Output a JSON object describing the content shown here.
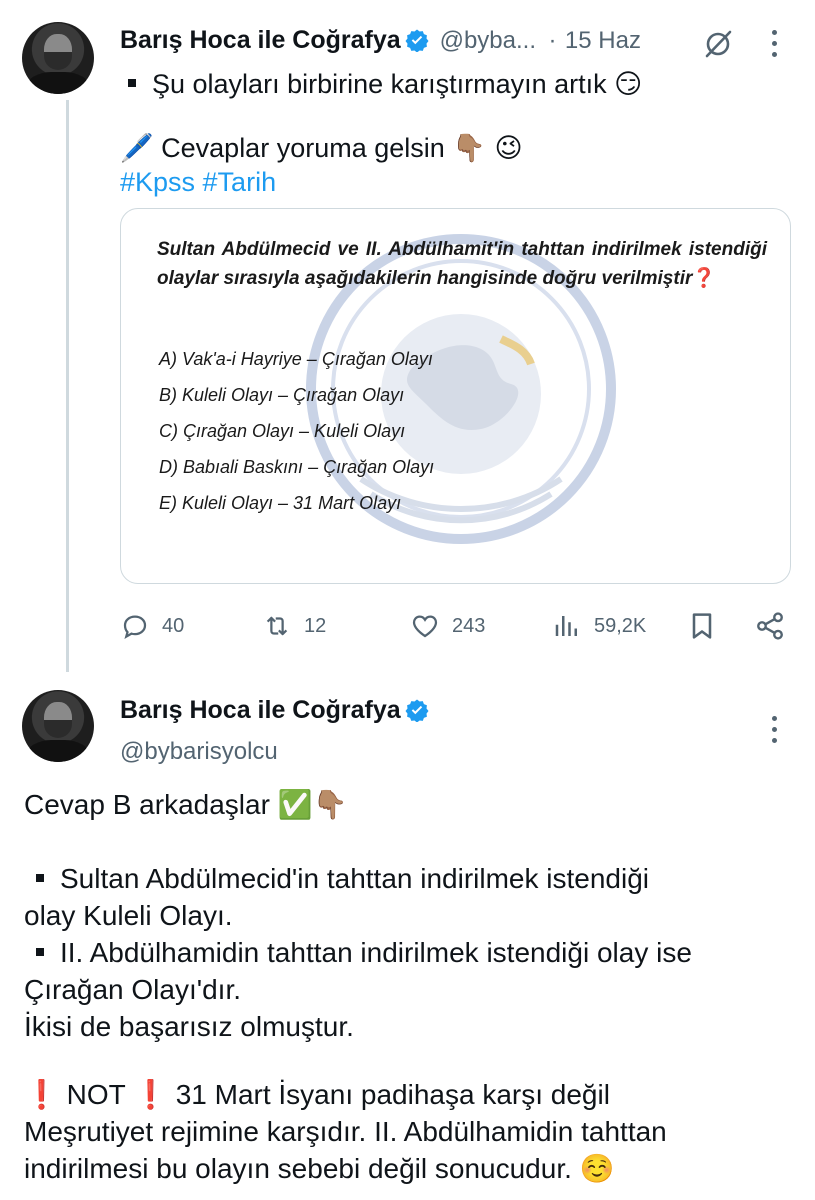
{
  "tweet1": {
    "author_name": "Barış Hoca ile Coğrafya",
    "handle": "@byba...",
    "dot": "·",
    "time": "15 Haz",
    "line1": "Şu olayları birbirine karıştırmayın artık",
    "line1_emoji": "😏",
    "line2_emoji": "🖊️",
    "line2": "Cevaplar yoruma gelsin",
    "line2_emoji_end": "👇🏽 😉",
    "hashtags": "#Kpss #Tarih",
    "image": {
      "question": "Sultan Abdülmecid ve II. Abdülhamit'in tahttan indirilmek istendiği olaylar sırasıyla aşağıdakilerin hangisinde doğru verilmiştir",
      "question_mark": "❓",
      "options": [
        "A) Vak'a-i Hayriye – Çırağan Olayı",
        "B) Kuleli Olayı – Çırağan Olayı",
        "C) Çırağan Olayı – Kuleli Olayı",
        "D) Babıali Baskını – Çırağan Olayı",
        "E) Kuleli Olayı – 31 Mart Olayı"
      ]
    },
    "stats": {
      "replies": "40",
      "retweets": "12",
      "likes": "243",
      "views": "59,2K"
    }
  },
  "tweet2": {
    "author_name": "Barış Hoca ile Coğrafya",
    "handle": "@bybarisyolcu",
    "body_line1": "Cevap B arkadaşlar",
    "body_line1_emoji": "✅👇🏽",
    "bullet1_a": "Sultan Abdülmecid'in tahttan indirilmek istendiği",
    "bullet1_b": "olay Kuleli Olayı.",
    "bullet2_a": "II. Abdülhamidin tahttan indirilmek istendiği olay ise",
    "bullet2_b": "Çırağan Olayı'dır.",
    "line_ikisi": "İkisi de başarısız olmuştur.",
    "note_mark": "❗",
    "note_label": "NOT",
    "note_a": "31 Mart İsyanı padihaşa karşı değil",
    "note_b": "Meşrutiyet rejimine karşıdır. II. Abdülhamidin tahttan",
    "note_c": "indirilmesi bu olayın sebebi değil sonucudur.",
    "note_emoji": "☺️"
  },
  "colors": {
    "accent": "#1d9bf0",
    "muted": "#536471",
    "thread_line": "#cfd9de",
    "alert": "#e0323e"
  },
  "icons": [
    "verified-badge-icon",
    "grok-icon",
    "more-icon",
    "reply-icon",
    "retweet-icon",
    "like-icon",
    "views-icon",
    "bookmark-icon",
    "share-icon"
  ]
}
